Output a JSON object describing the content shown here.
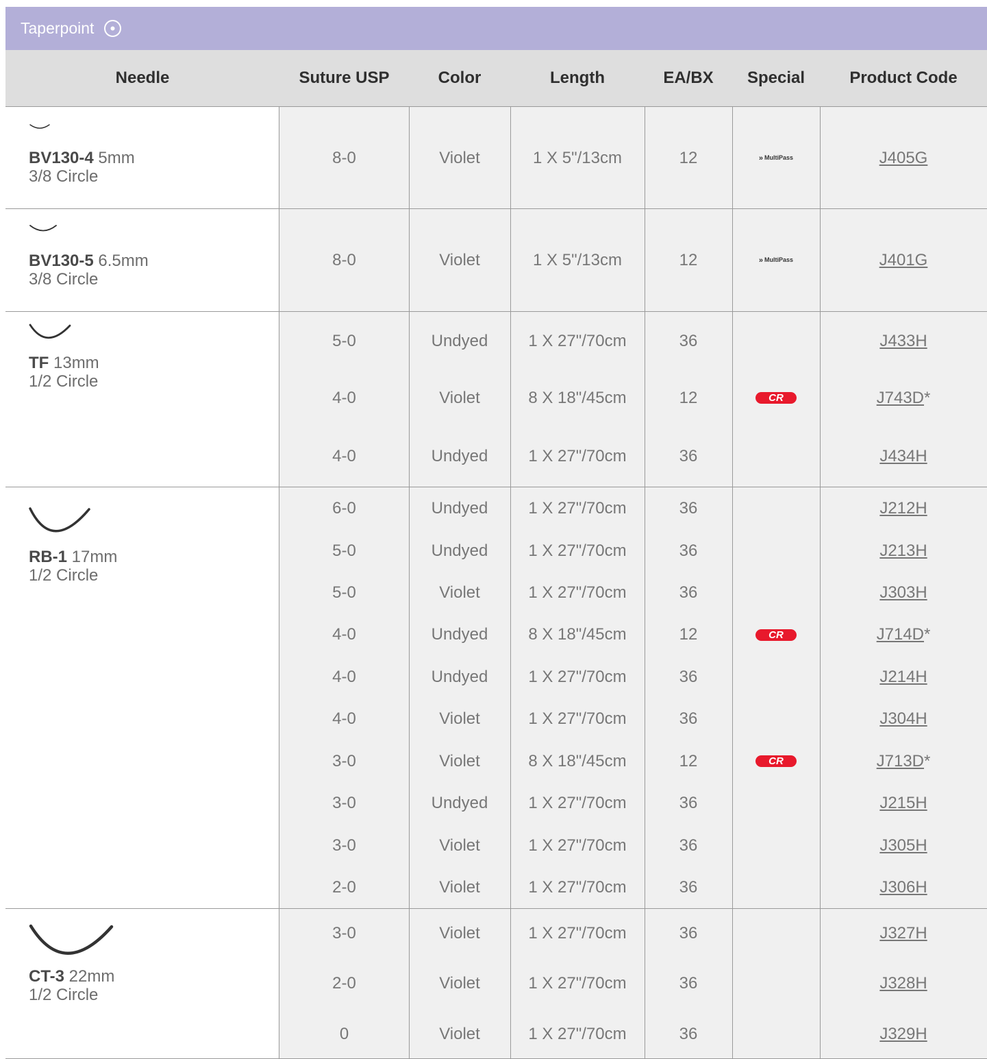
{
  "section": {
    "title": "Taperpoint",
    "icon": "circle-dot-icon"
  },
  "columns": [
    "Needle",
    "Suture USP",
    "Color",
    "Length",
    "EA/BX",
    "Special",
    "Product Code"
  ],
  "groups": [
    {
      "needle": {
        "name": "BV130-4",
        "size": "5mm",
        "shape": "3/8 Circle",
        "icon": "needle-curve-icon"
      },
      "rows": [
        {
          "usp": "8-0",
          "color": "Violet",
          "length": "1 X 5\"/13cm",
          "eabx": "12",
          "special": "MultiPass",
          "code": "J405G"
        }
      ]
    },
    {
      "needle": {
        "name": "BV130-5",
        "size": "6.5mm",
        "shape": "3/8 Circle",
        "icon": "needle-curve-icon"
      },
      "rows": [
        {
          "usp": "8-0",
          "color": "Violet",
          "length": "1 X 5\"/13cm",
          "eabx": "12",
          "special": "MultiPass",
          "code": "J401G"
        }
      ]
    },
    {
      "needle": {
        "name": "TF",
        "size": "13mm",
        "shape": "1/2 Circle",
        "icon": "needle-curve-icon"
      },
      "rows": [
        {
          "usp": "5-0",
          "color": "Undyed",
          "length": "1 X 27\"/70cm",
          "eabx": "36",
          "special": "",
          "code": "J433H"
        },
        {
          "usp": "4-0",
          "color": "Violet",
          "length": "8 X 18\"/45cm",
          "eabx": "12",
          "special": "CR",
          "code": "J743D*"
        },
        {
          "usp": "4-0",
          "color": "Undyed",
          "length": "1 X 27\"/70cm",
          "eabx": "36",
          "special": "",
          "code": "J434H"
        }
      ]
    },
    {
      "needle": {
        "name": "RB-1",
        "size": "17mm",
        "shape": "1/2 Circle",
        "icon": "needle-curve-icon"
      },
      "rows": [
        {
          "usp": "6-0",
          "color": "Undyed",
          "length": "1 X 27\"/70cm",
          "eabx": "36",
          "special": "",
          "code": "J212H"
        },
        {
          "usp": "5-0",
          "color": "Undyed",
          "length": "1 X 27\"/70cm",
          "eabx": "36",
          "special": "",
          "code": "J213H"
        },
        {
          "usp": "5-0",
          "color": "Violet",
          "length": "1 X 27\"/70cm",
          "eabx": "36",
          "special": "",
          "code": "J303H"
        },
        {
          "usp": "4-0",
          "color": "Undyed",
          "length": "8 X 18\"/45cm",
          "eabx": "12",
          "special": "CR",
          "code": "J714D*"
        },
        {
          "usp": "4-0",
          "color": "Undyed",
          "length": "1 X 27\"/70cm",
          "eabx": "36",
          "special": "",
          "code": "J214H"
        },
        {
          "usp": "4-0",
          "color": "Violet",
          "length": "1 X 27\"/70cm",
          "eabx": "36",
          "special": "",
          "code": "J304H"
        },
        {
          "usp": "3-0",
          "color": "Violet",
          "length": "8 X 18\"/45cm",
          "eabx": "12",
          "special": "CR",
          "code": "J713D*"
        },
        {
          "usp": "3-0",
          "color": "Undyed",
          "length": "1 X 27\"/70cm",
          "eabx": "36",
          "special": "",
          "code": "J215H"
        },
        {
          "usp": "3-0",
          "color": "Violet",
          "length": "1 X 27\"/70cm",
          "eabx": "36",
          "special": "",
          "code": "J305H"
        },
        {
          "usp": "2-0",
          "color": "Violet",
          "length": "1 X 27\"/70cm",
          "eabx": "36",
          "special": "",
          "code": "J306H"
        }
      ]
    },
    {
      "needle": {
        "name": "CT-3",
        "size": "22mm",
        "shape": "1/2 Circle",
        "icon": "needle-curve-icon"
      },
      "rows": [
        {
          "usp": "3-0",
          "color": "Violet",
          "length": "1 X 27\"/70cm",
          "eabx": "36",
          "special": "",
          "code": "J327H"
        },
        {
          "usp": "2-0",
          "color": "Violet",
          "length": "1 X 27\"/70cm",
          "eabx": "36",
          "special": "",
          "code": "J328H"
        },
        {
          "usp": "0",
          "color": "Violet",
          "length": "1 X 27\"/70cm",
          "eabx": "36",
          "special": "",
          "code": "J329H"
        }
      ]
    }
  ],
  "colors": {
    "band": "#b3afd8",
    "header": "#dedede",
    "data_bg": "#f0f0f0",
    "cr_badge": "#e8192c"
  }
}
